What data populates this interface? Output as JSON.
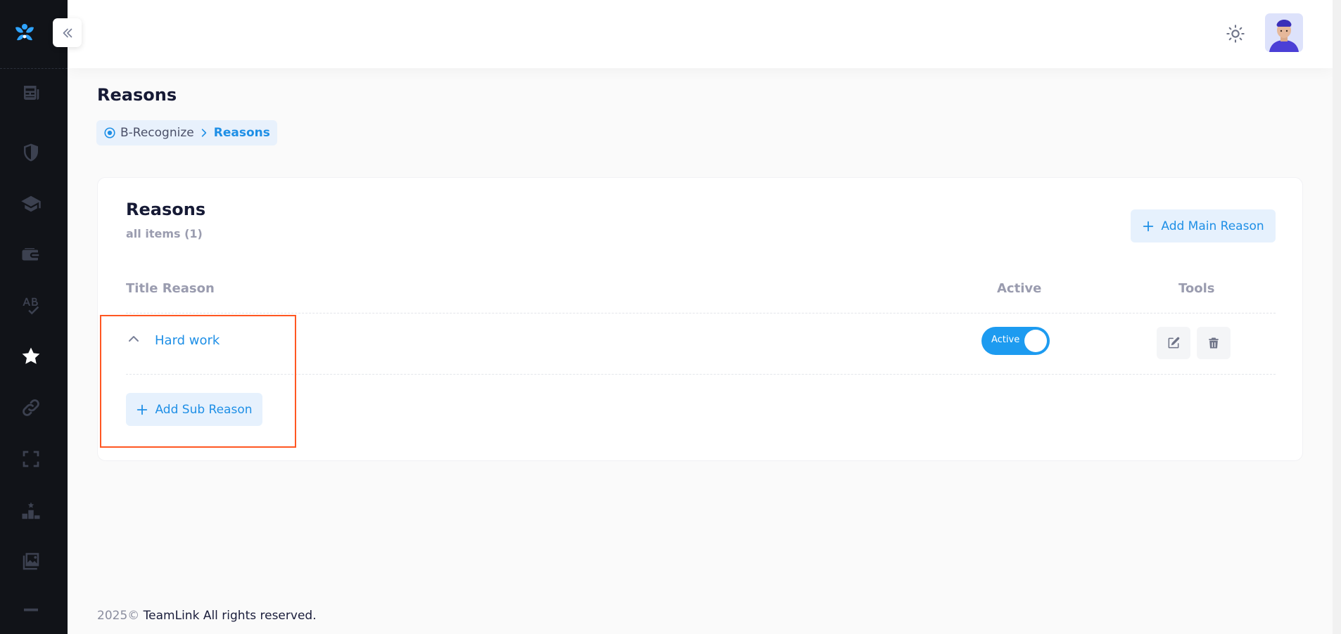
{
  "page": {
    "title": "Reasons",
    "breadcrumb": {
      "home": "B-Recognize",
      "current": "Reasons"
    }
  },
  "card": {
    "title": "Reasons",
    "subtitle": "all items (1)",
    "add_main_label": "Add Main Reason",
    "columns": {
      "title": "Title Reason",
      "active": "Active",
      "tools": "Tools"
    },
    "rows": [
      {
        "title": "Hard work",
        "status_label": "Active",
        "active": true
      }
    ],
    "add_sub_label": "Add Sub Reason"
  },
  "footer": {
    "year": "2025©",
    "company": "TeamLink All rights reserved."
  },
  "sidebar": {
    "items": [
      {
        "icon": "newspaper-icon"
      },
      {
        "icon": "shield-icon"
      },
      {
        "icon": "graduation-cap-icon"
      },
      {
        "icon": "wallet-icon"
      },
      {
        "icon": "spellcheck-icon"
      },
      {
        "icon": "star-icon",
        "active": true
      },
      {
        "icon": "link-icon"
      },
      {
        "icon": "fullscreen-icon"
      },
      {
        "icon": "leaderboard-icon"
      },
      {
        "icon": "images-icon"
      }
    ]
  },
  "colors": {
    "accent": "#1e8fe6",
    "sidebar_bg": "#111318",
    "highlight": "#ff5722"
  }
}
